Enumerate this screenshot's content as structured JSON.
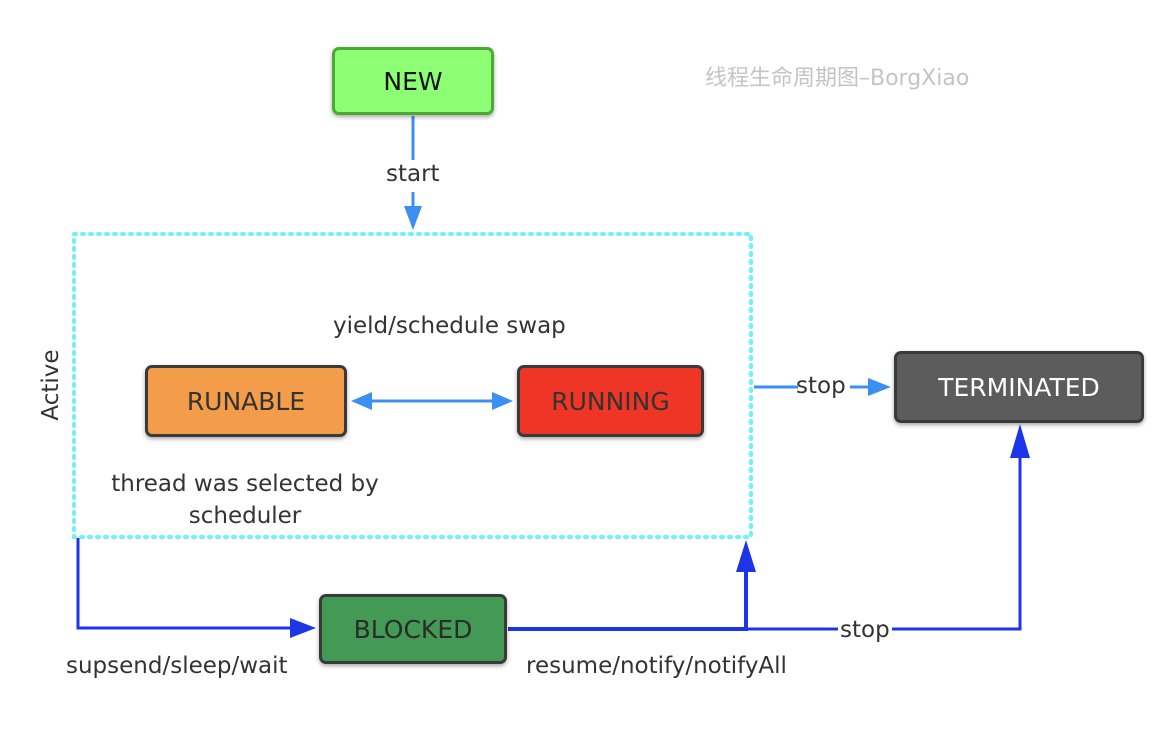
{
  "diagram": {
    "title": "线程生命周期图–BorgXiao",
    "container_label": "Active",
    "nodes": {
      "new": "NEW",
      "runable": "RUNABLE",
      "running": "RUNNING",
      "terminated": "TERMINATED",
      "blocked": "BLOCKED"
    },
    "edges": {
      "start": "start",
      "yield_swap": "yield/schedule swap",
      "selected": "thread was selected by scheduler",
      "stop_active": "stop",
      "stop_blocked": "stop",
      "suspend": "supsend/sleep/wait",
      "resume": "resume/notify/notifyAll"
    },
    "colors": {
      "new": "#8cff75",
      "runable": "#f39c4a",
      "running": "#ee3526",
      "terminated": "#5c5c5c",
      "blocked": "#429a55",
      "arrow_light": "#3a8ff0",
      "arrow_dark": "#1c35e8",
      "container_border": "#6ff3f6"
    }
  }
}
